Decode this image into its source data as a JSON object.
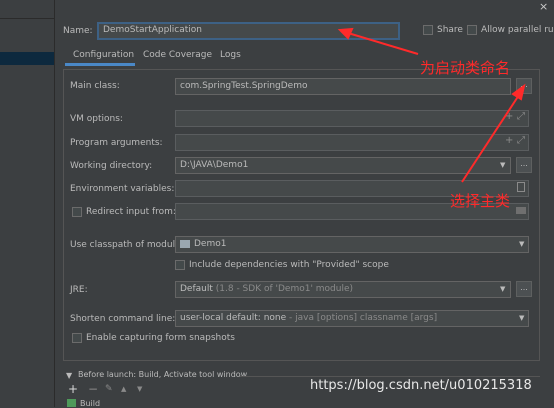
{
  "window": {
    "close_glyph": "×"
  },
  "name": {
    "label": "Name:",
    "value": "DemoStartApplication"
  },
  "options": {
    "share": "Share",
    "parallel": "Allow parallel run"
  },
  "tabs": [
    {
      "label": "Configuration",
      "active": true
    },
    {
      "label": "Code Coverage",
      "active": false
    },
    {
      "label": "Logs",
      "active": false
    }
  ],
  "form": {
    "main_class": {
      "label": "Main class:",
      "value": "com.SpringTest.SpringDemo"
    },
    "vm_options": {
      "label": "VM options:",
      "value": ""
    },
    "program_args": {
      "label": "Program arguments:",
      "value": ""
    },
    "working_dir": {
      "label": "Working directory:",
      "value": "D:\\JAVA\\Demo1"
    },
    "env_vars": {
      "label": "Environment variables:",
      "value": ""
    },
    "redirect": {
      "label": "Redirect input from:",
      "value": ""
    },
    "classpath": {
      "label": "Use classpath of module:",
      "value": "Demo1"
    },
    "include_deps": {
      "label": "Include dependencies with \"Provided\" scope"
    },
    "jre": {
      "label": "JRE:",
      "value_main": "Default",
      "value_dim": "(1.8 - SDK of 'Demo1' module)"
    },
    "shorten": {
      "label": "Shorten command line:",
      "value_main": "user-local default: none",
      "value_dim": " - java [options] classname [args]"
    },
    "capture": {
      "label": "Enable capturing form snapshots"
    }
  },
  "before_launch": {
    "label": "Before launch: Build, Activate tool window",
    "item": "Build"
  },
  "toolbar_glyphs": {
    "add": "+",
    "remove": "−",
    "edit": "✎",
    "up": "▲",
    "down": "▼"
  },
  "buttons": {
    "browse": "...",
    "expand": "⤢",
    "add": "+"
  },
  "annotations": {
    "arrow1_text": "为启动类命名",
    "arrow2_text": "选择主类",
    "color": "#ff2a2a"
  },
  "watermark": "https://blog.csdn.net/u010215318",
  "colors": {
    "background": "#3c3f41",
    "field": "#45494a",
    "accent": "#4a88c7",
    "focus": "#3d6185"
  }
}
